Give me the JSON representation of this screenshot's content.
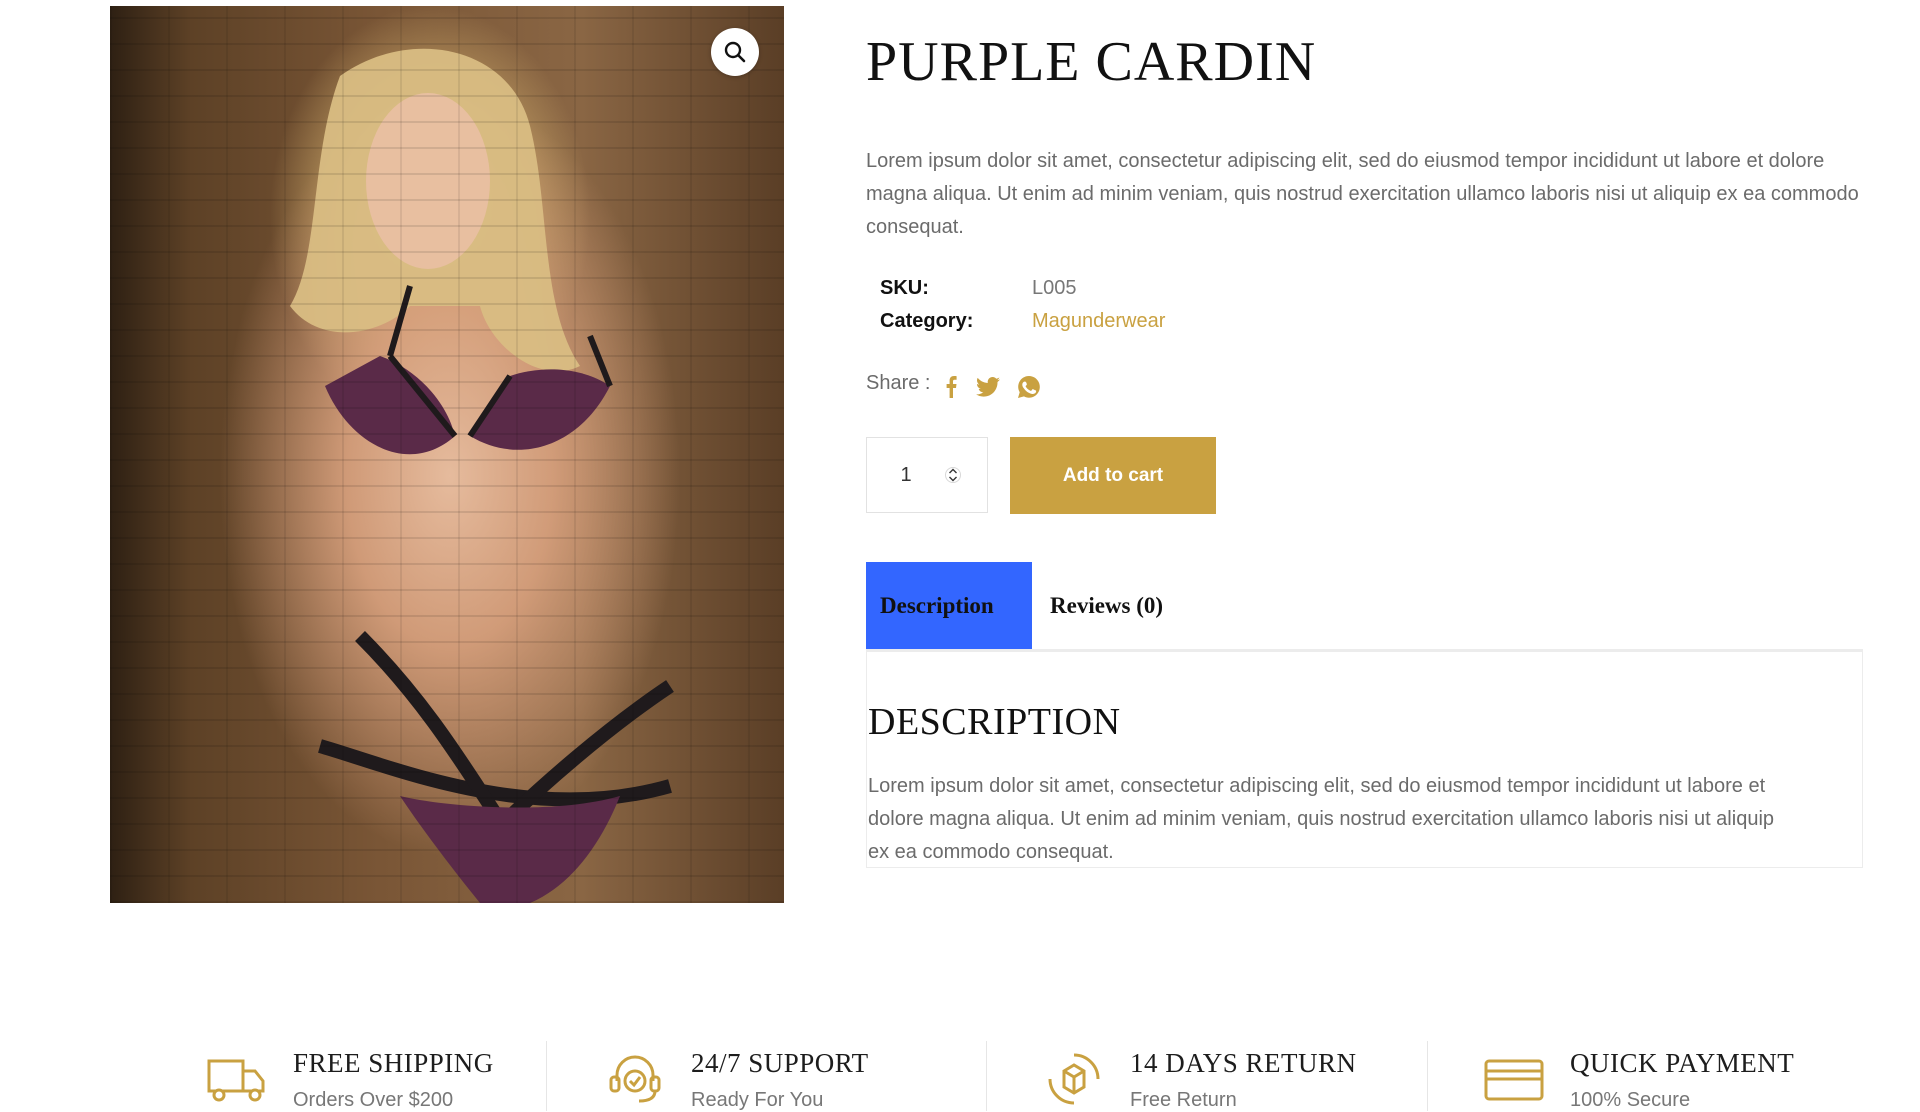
{
  "product": {
    "title": "PURPLE CARDIN",
    "short_description": "Lorem ipsum dolor sit amet, consectetur adipiscing elit, sed do eiusmod tempor incididunt ut labore et dolore magna aliqua. Ut enim ad minim veniam, quis nostrud exercitation ullamco laboris nisi ut aliquip ex ea commodo consequat.",
    "sku_label": "SKU:",
    "sku_value": "L005",
    "category_label": "Category:",
    "category_value": "Magunderwear",
    "share_label": "Share :",
    "share_icons": [
      "facebook-icon",
      "twitter-icon",
      "whatsapp-icon"
    ],
    "quantity": "1",
    "add_to_cart_label": "Add to cart"
  },
  "tabs": {
    "description_label": "Description",
    "reviews_label": "Reviews (0)",
    "active": "Description"
  },
  "panel": {
    "heading": "DESCRIPTION",
    "text": "Lorem ipsum dolor sit amet, consectetur adipiscing elit, sed do eiusmod tempor incididunt ut labore et dolore magna aliqua. Ut enim ad minim veniam, quis nostrud exercitation ullamco laboris nisi ut aliquip ex ea commodo consequat."
  },
  "features": [
    {
      "icon": "truck-icon",
      "title": "FREE SHIPPING",
      "subtitle": "Orders Over $200"
    },
    {
      "icon": "headset-icon",
      "title": "24/7 SUPPORT",
      "subtitle": "Ready For You"
    },
    {
      "icon": "box-return-icon",
      "title": "14 DAYS RETURN",
      "subtitle": "Free Return"
    },
    {
      "icon": "credit-card-icon",
      "title": "QUICK PAYMENT",
      "subtitle": "100% Secure"
    }
  ],
  "colors": {
    "accent_gold": "#c9a141",
    "active_tab": "#3366ff",
    "body_text": "#6b6b6b"
  }
}
